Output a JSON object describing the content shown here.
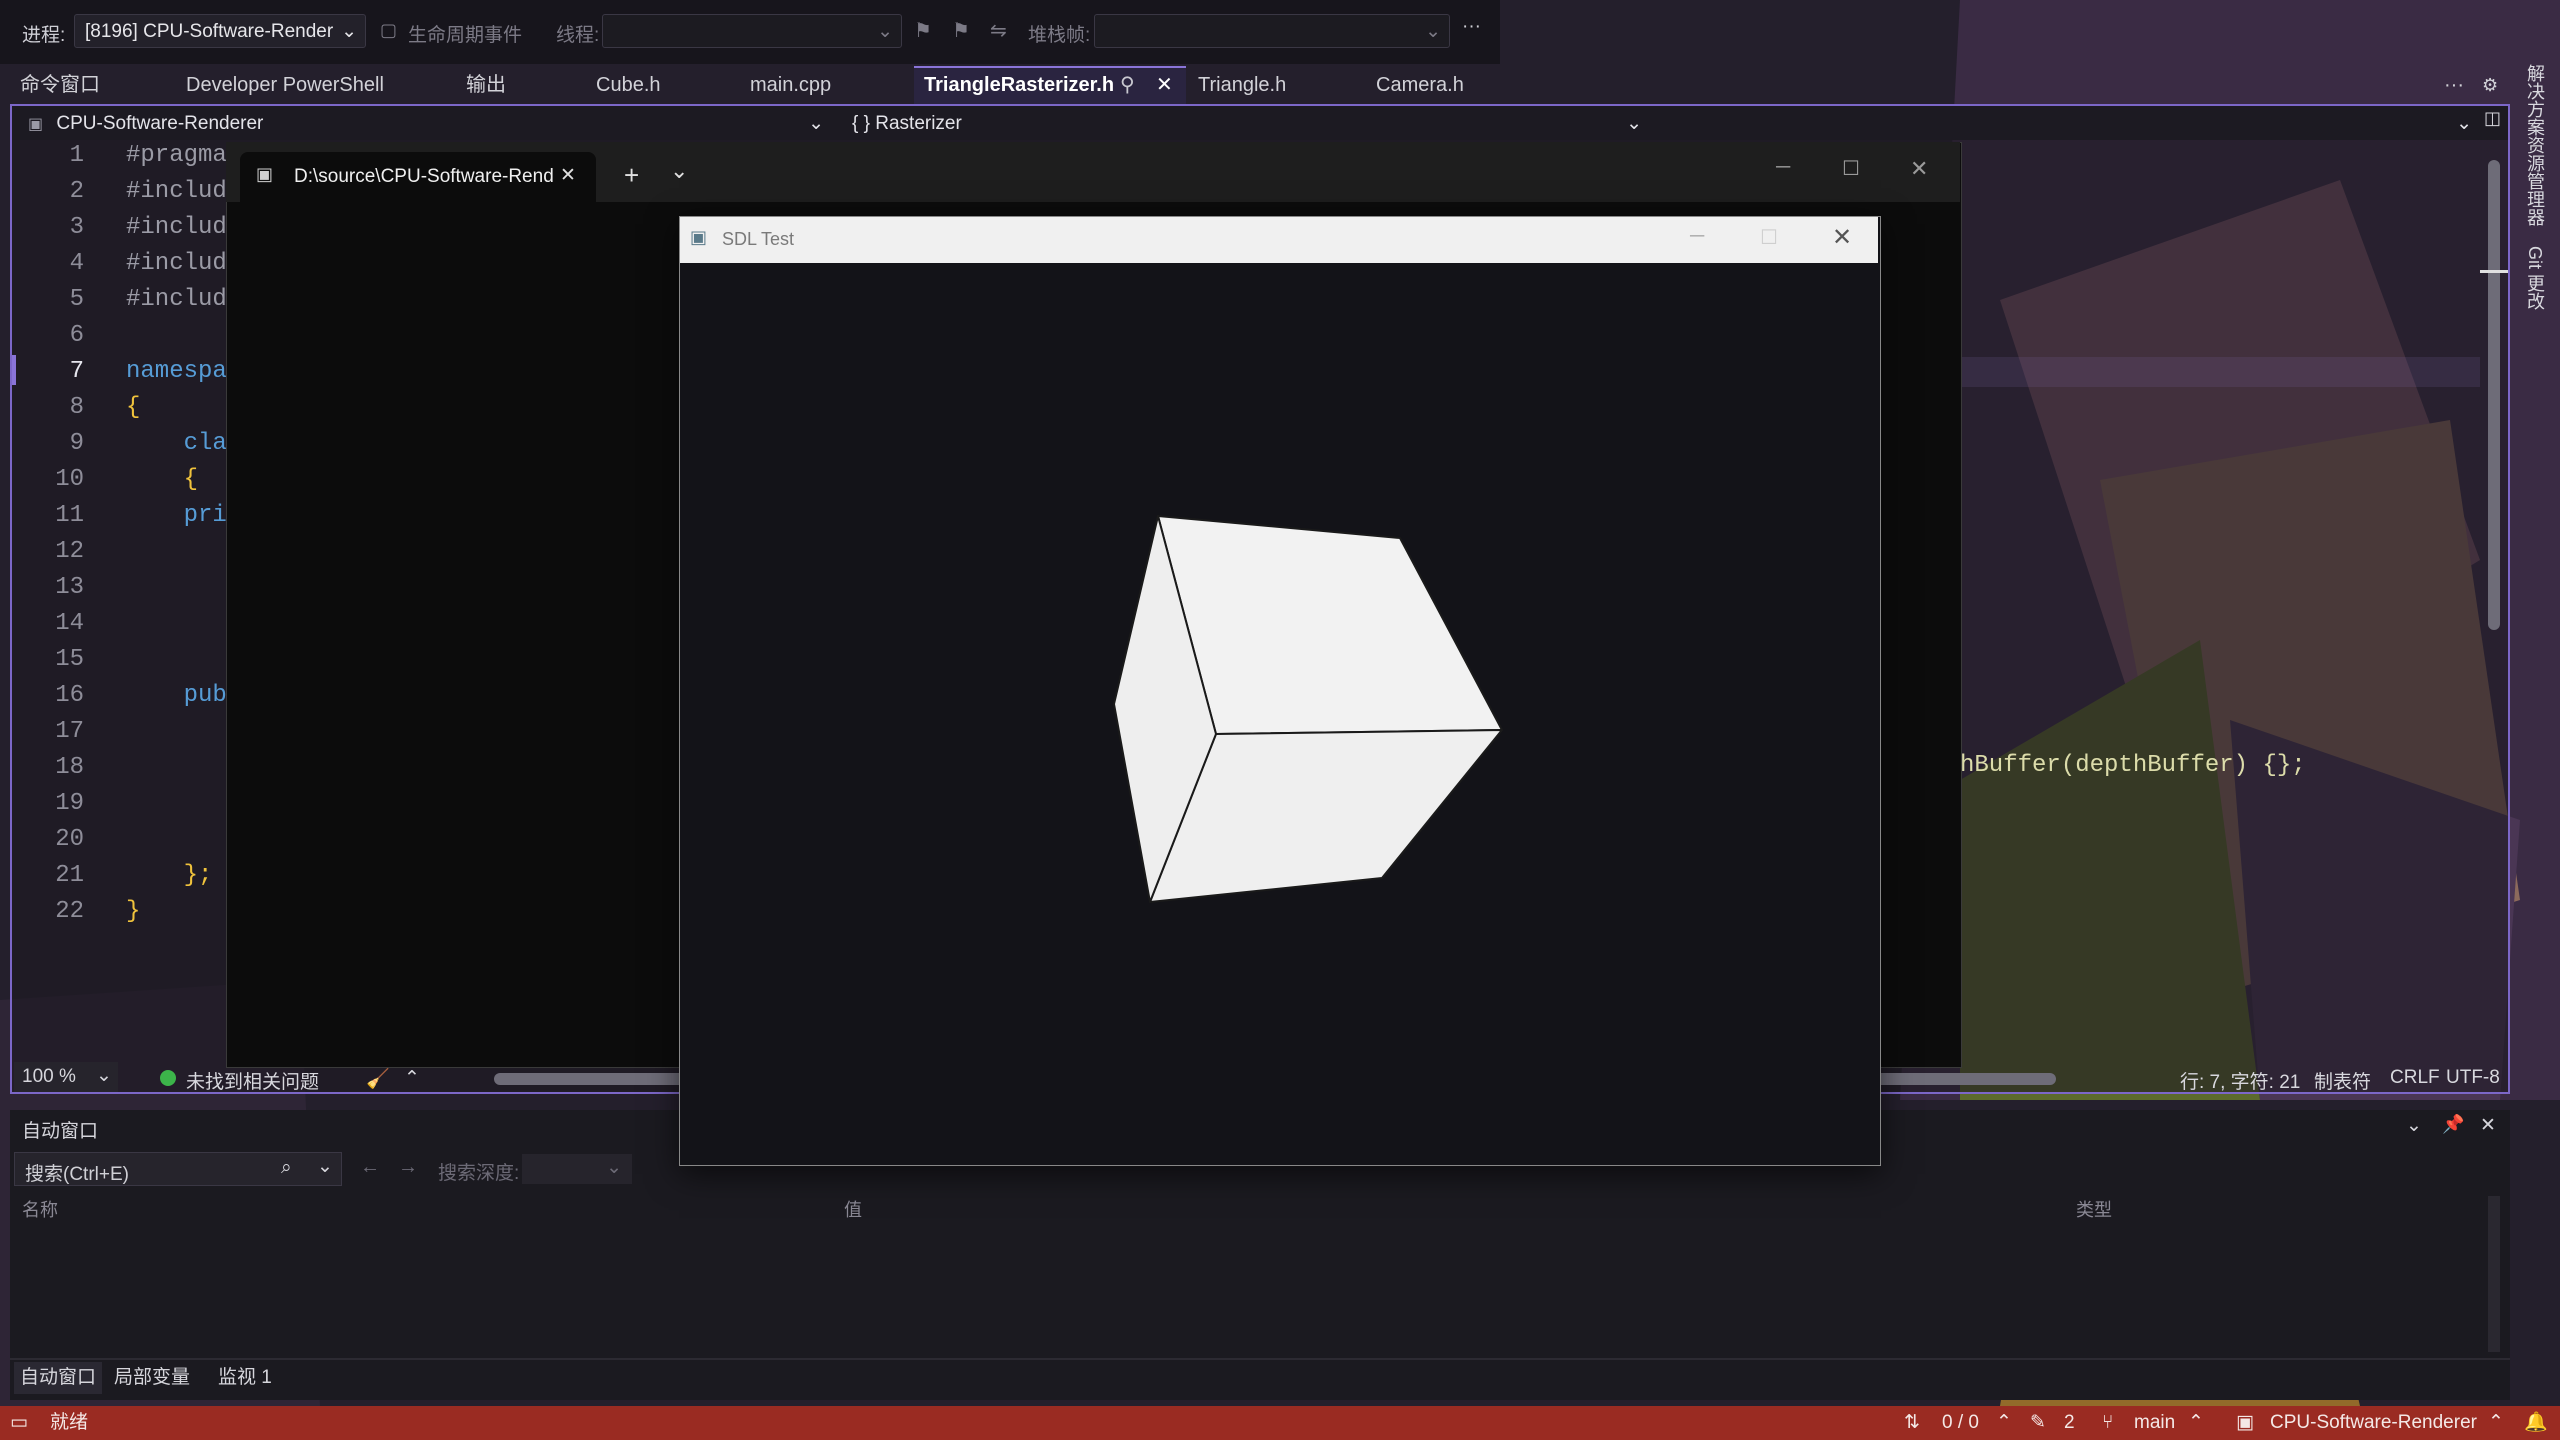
{
  "debug_toolbar": {
    "process_label": "进程:",
    "process_value": "[8196] CPU-Software-Render",
    "lifecycle_label": "生命周期事件",
    "thread_label": "线程:",
    "thread_value": "",
    "stackframe_label": "堆栈帧:",
    "stackframe_value": "",
    "more_label": "···"
  },
  "doc_tabs": [
    "命令窗口",
    "Developer PowerShell",
    "输出",
    "Cube.h",
    "main.cpp",
    "TriangleRasterizer.h",
    "Triangle.h",
    "Camera.h"
  ],
  "active_tab": "TriangleRasterizer.h",
  "tab_overflow_label": "···",
  "nav": {
    "project": "CPU-Software-Renderer",
    "scope": "{ } Rasterizer",
    "member": ""
  },
  "code_lines": [
    {
      "n": "1",
      "text": "#pragma"
    },
    {
      "n": "2",
      "text": "#includ"
    },
    {
      "n": "3",
      "text": "#includ"
    },
    {
      "n": "4",
      "text": "#includ"
    },
    {
      "n": "5",
      "text": "#includ"
    },
    {
      "n": "6",
      "text": ""
    },
    {
      "n": "7",
      "text": "namespa"
    },
    {
      "n": "8",
      "text": "{"
    },
    {
      "n": "9",
      "text": "    cla"
    },
    {
      "n": "10",
      "text": "    {"
    },
    {
      "n": "11",
      "text": "    pri"
    },
    {
      "n": "12",
      "text": ""
    },
    {
      "n": "13",
      "text": ""
    },
    {
      "n": "14",
      "text": ""
    },
    {
      "n": "15",
      "text": ""
    },
    {
      "n": "16",
      "text": "    pub"
    },
    {
      "n": "17",
      "text": ""
    },
    {
      "n": "18",
      "text": ""
    },
    {
      "n": "19",
      "text": ""
    },
    {
      "n": "20",
      "text": ""
    },
    {
      "n": "21",
      "text": "    };"
    },
    {
      "n": "22",
      "text": "}"
    }
  ],
  "code_fragment_right": "hBuffer(depthBuffer) {};",
  "terminal": {
    "tab_title": "D:\\source\\CPU-Software-Rend",
    "new_tab": "+",
    "dropdown": "⌄"
  },
  "sdl_window": {
    "title": "SDL Test"
  },
  "editor_status": {
    "zoom": "100 %",
    "issues": "未找到相关问题",
    "position": "行: 7, 字符: 21",
    "indent": "制表符",
    "line_ending": "CRLF",
    "encoding": "UTF-8"
  },
  "auto_window": {
    "title": "自动窗口",
    "search_placeholder": "搜索(Ctrl+E)",
    "search_depth_label": "搜索深度:",
    "columns": [
      "名称",
      "值",
      "类型"
    ],
    "bottom_tabs": [
      "自动窗口",
      "局部变量",
      "监视 1"
    ]
  },
  "status_bar": {
    "ready": "就绪",
    "sync": "0 / 0",
    "edits": "2",
    "branch": "main",
    "repo": "CPU-Software-Renderer"
  },
  "right_side_labels": [
    "解决方案资源管理器",
    "Git 更改"
  ]
}
